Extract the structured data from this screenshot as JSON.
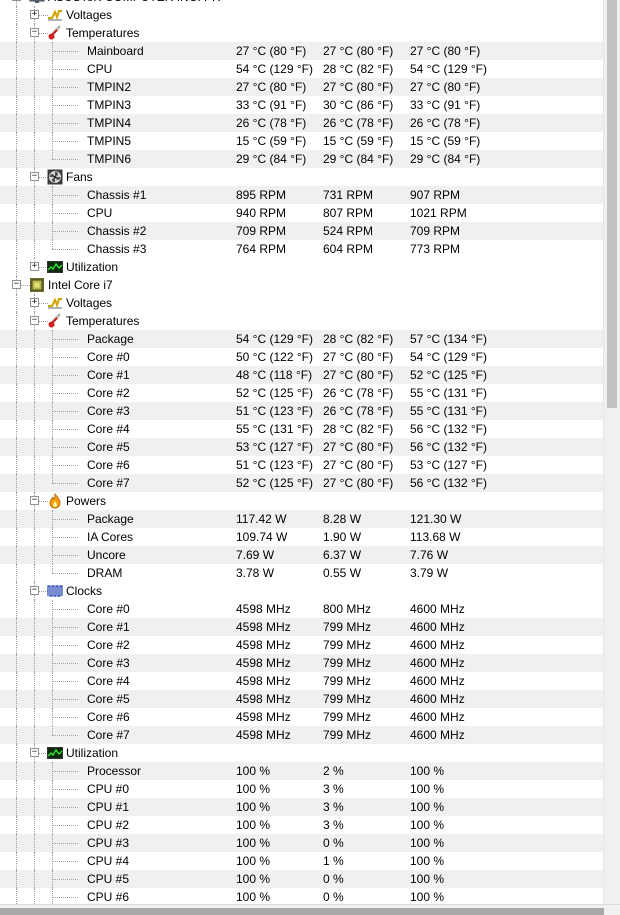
{
  "tree": [
    {
      "depth": 0,
      "kind": "group",
      "icon": "monitor-icon",
      "label": "ASUSTeK COMPUTER INC. PR",
      "expander": "−",
      "last": false
    },
    {
      "depth": 1,
      "kind": "group",
      "icon": "voltage-icon",
      "label": "Voltages",
      "expander": "+",
      "last": false
    },
    {
      "depth": 1,
      "kind": "group",
      "icon": "thermometer-icon",
      "label": "Temperatures",
      "expander": "−",
      "last": false
    },
    {
      "depth": 2,
      "kind": "sensor",
      "label": "Mainboard",
      "values": [
        "27 °C  (80 °F)",
        "27 °C  (80 °F)",
        "27 °C  (80 °F)"
      ]
    },
    {
      "depth": 2,
      "kind": "sensor",
      "label": "CPU",
      "values": [
        "54 °C  (129 °F)",
        "28 °C  (82 °F)",
        "54 °C  (129 °F)"
      ]
    },
    {
      "depth": 2,
      "kind": "sensor",
      "label": "TMPIN2",
      "values": [
        "27 °C  (80 °F)",
        "27 °C  (80 °F)",
        "27 °C  (80 °F)"
      ]
    },
    {
      "depth": 2,
      "kind": "sensor",
      "label": "TMPIN3",
      "values": [
        "33 °C  (91 °F)",
        "30 °C  (86 °F)",
        "33 °C  (91 °F)"
      ]
    },
    {
      "depth": 2,
      "kind": "sensor",
      "label": "TMPIN4",
      "values": [
        "26 °C  (78 °F)",
        "26 °C  (78 °F)",
        "26 °C  (78 °F)"
      ]
    },
    {
      "depth": 2,
      "kind": "sensor",
      "label": "TMPIN5",
      "values": [
        "15 °C  (59 °F)",
        "15 °C  (59 °F)",
        "15 °C  (59 °F)"
      ]
    },
    {
      "depth": 2,
      "kind": "sensor",
      "label": "TMPIN6",
      "values": [
        "29 °C  (84 °F)",
        "29 °C  (84 °F)",
        "29 °C  (84 °F)"
      ],
      "last": true
    },
    {
      "depth": 1,
      "kind": "group",
      "icon": "fan-icon",
      "label": "Fans",
      "expander": "−",
      "last": false
    },
    {
      "depth": 2,
      "kind": "sensor",
      "label": "Chassis #1",
      "values": [
        "895 RPM",
        "731 RPM",
        "907 RPM"
      ]
    },
    {
      "depth": 2,
      "kind": "sensor",
      "label": "CPU",
      "values": [
        "940 RPM",
        "807 RPM",
        "1021 RPM"
      ]
    },
    {
      "depth": 2,
      "kind": "sensor",
      "label": "Chassis #2",
      "values": [
        "709 RPM",
        "524 RPM",
        "709 RPM"
      ]
    },
    {
      "depth": 2,
      "kind": "sensor",
      "label": "Chassis #3",
      "values": [
        "764 RPM",
        "604 RPM",
        "773 RPM"
      ],
      "last": true
    },
    {
      "depth": 1,
      "kind": "group",
      "icon": "utilization-icon",
      "label": "Utilization",
      "expander": "+",
      "last": true
    },
    {
      "depth": 0,
      "kind": "group",
      "icon": "cpu-chip-icon",
      "label": "Intel Core i7",
      "expander": "−",
      "last": false
    },
    {
      "depth": 1,
      "kind": "group",
      "icon": "voltage-icon",
      "label": "Voltages",
      "expander": "+",
      "last": false
    },
    {
      "depth": 1,
      "kind": "group",
      "icon": "thermometer-icon",
      "label": "Temperatures",
      "expander": "−",
      "last": false
    },
    {
      "depth": 2,
      "kind": "sensor",
      "label": "Package",
      "values": [
        "54 °C  (129 °F)",
        "28 °C  (82 °F)",
        "57 °C  (134 °F)"
      ]
    },
    {
      "depth": 2,
      "kind": "sensor",
      "label": "Core #0",
      "values": [
        "50 °C  (122 °F)",
        "27 °C  (80 °F)",
        "54 °C  (129 °F)"
      ]
    },
    {
      "depth": 2,
      "kind": "sensor",
      "label": "Core #1",
      "values": [
        "48 °C  (118 °F)",
        "27 °C  (80 °F)",
        "52 °C  (125 °F)"
      ]
    },
    {
      "depth": 2,
      "kind": "sensor",
      "label": "Core #2",
      "values": [
        "52 °C  (125 °F)",
        "26 °C  (78 °F)",
        "55 °C  (131 °F)"
      ]
    },
    {
      "depth": 2,
      "kind": "sensor",
      "label": "Core #3",
      "values": [
        "51 °C  (123 °F)",
        "26 °C  (78 °F)",
        "55 °C  (131 °F)"
      ]
    },
    {
      "depth": 2,
      "kind": "sensor",
      "label": "Core #4",
      "values": [
        "55 °C  (131 °F)",
        "28 °C  (82 °F)",
        "56 °C  (132 °F)"
      ]
    },
    {
      "depth": 2,
      "kind": "sensor",
      "label": "Core #5",
      "values": [
        "53 °C  (127 °F)",
        "27 °C  (80 °F)",
        "56 °C  (132 °F)"
      ]
    },
    {
      "depth": 2,
      "kind": "sensor",
      "label": "Core #6",
      "values": [
        "51 °C  (123 °F)",
        "27 °C  (80 °F)",
        "53 °C  (127 °F)"
      ]
    },
    {
      "depth": 2,
      "kind": "sensor",
      "label": "Core #7",
      "values": [
        "52 °C  (125 °F)",
        "27 °C  (80 °F)",
        "56 °C  (132 °F)"
      ],
      "last": true
    },
    {
      "depth": 1,
      "kind": "group",
      "icon": "power-flame-icon",
      "label": "Powers",
      "expander": "−",
      "last": false
    },
    {
      "depth": 2,
      "kind": "sensor",
      "label": "Package",
      "values": [
        "117.42 W",
        "8.28 W",
        "121.30 W"
      ]
    },
    {
      "depth": 2,
      "kind": "sensor",
      "label": "IA Cores",
      "values": [
        "109.74 W",
        "1.90 W",
        "113.68 W"
      ]
    },
    {
      "depth": 2,
      "kind": "sensor",
      "label": "Uncore",
      "values": [
        "7.69 W",
        "6.37 W",
        "7.76 W"
      ]
    },
    {
      "depth": 2,
      "kind": "sensor",
      "label": "DRAM",
      "values": [
        "3.78 W",
        "0.55 W",
        "3.79 W"
      ],
      "last": true
    },
    {
      "depth": 1,
      "kind": "group",
      "icon": "clock-wave-icon",
      "label": "Clocks",
      "expander": "−",
      "last": false
    },
    {
      "depth": 2,
      "kind": "sensor",
      "label": "Core #0",
      "values": [
        "4598 MHz",
        "800 MHz",
        "4600 MHz"
      ]
    },
    {
      "depth": 2,
      "kind": "sensor",
      "label": "Core #1",
      "values": [
        "4598 MHz",
        "799 MHz",
        "4600 MHz"
      ]
    },
    {
      "depth": 2,
      "kind": "sensor",
      "label": "Core #2",
      "values": [
        "4598 MHz",
        "799 MHz",
        "4600 MHz"
      ]
    },
    {
      "depth": 2,
      "kind": "sensor",
      "label": "Core #3",
      "values": [
        "4598 MHz",
        "799 MHz",
        "4600 MHz"
      ]
    },
    {
      "depth": 2,
      "kind": "sensor",
      "label": "Core #4",
      "values": [
        "4598 MHz",
        "799 MHz",
        "4600 MHz"
      ]
    },
    {
      "depth": 2,
      "kind": "sensor",
      "label": "Core #5",
      "values": [
        "4598 MHz",
        "799 MHz",
        "4600 MHz"
      ]
    },
    {
      "depth": 2,
      "kind": "sensor",
      "label": "Core #6",
      "values": [
        "4598 MHz",
        "799 MHz",
        "4600 MHz"
      ]
    },
    {
      "depth": 2,
      "kind": "sensor",
      "label": "Core #7",
      "values": [
        "4598 MHz",
        "799 MHz",
        "4600 MHz"
      ],
      "last": true
    },
    {
      "depth": 1,
      "kind": "group",
      "icon": "utilization-icon",
      "label": "Utilization",
      "expander": "−",
      "last": false
    },
    {
      "depth": 2,
      "kind": "sensor",
      "label": "Processor",
      "values": [
        "100 %",
        "2 %",
        "100 %"
      ]
    },
    {
      "depth": 2,
      "kind": "sensor",
      "label": "CPU #0",
      "values": [
        "100 %",
        "3 %",
        "100 %"
      ]
    },
    {
      "depth": 2,
      "kind": "sensor",
      "label": "CPU #1",
      "values": [
        "100 %",
        "3 %",
        "100 %"
      ]
    },
    {
      "depth": 2,
      "kind": "sensor",
      "label": "CPU #2",
      "values": [
        "100 %",
        "3 %",
        "100 %"
      ]
    },
    {
      "depth": 2,
      "kind": "sensor",
      "label": "CPU #3",
      "values": [
        "100 %",
        "0 %",
        "100 %"
      ]
    },
    {
      "depth": 2,
      "kind": "sensor",
      "label": "CPU #4",
      "values": [
        "100 %",
        "1 %",
        "100 %"
      ]
    },
    {
      "depth": 2,
      "kind": "sensor",
      "label": "CPU #5",
      "values": [
        "100 %",
        "0 %",
        "100 %"
      ]
    },
    {
      "depth": 2,
      "kind": "sensor",
      "label": "CPU #6",
      "values": [
        "100 %",
        "0 %",
        "100 %"
      ]
    }
  ],
  "colors": {
    "stripe": "#f0f0f0",
    "scroll_thumb": "#c2c2c2"
  }
}
